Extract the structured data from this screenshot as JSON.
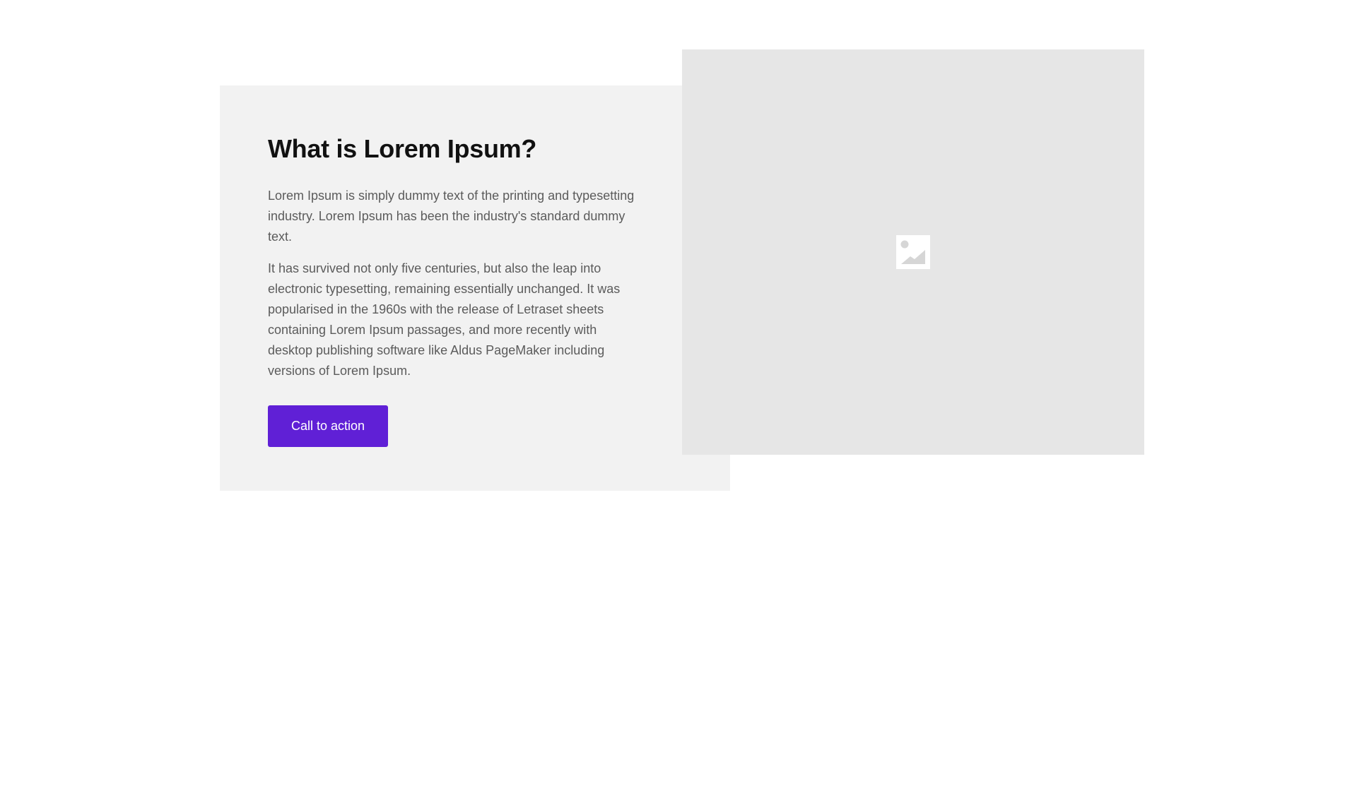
{
  "section": {
    "heading": "What is Lorem Ipsum?",
    "paragraphs": [
      "Lorem Ipsum is simply dummy text of the printing and typesetting industry. Lorem Ipsum has been the industry's standard dummy text.",
      "It has survived not only five centuries, but also the leap into electronic typesetting, remaining essentially unchanged. It was popularised in the 1960s with the release of Letraset sheets containing Lorem Ipsum passages, and more recently with desktop publishing software like Aldus PageMaker including versions of Lorem Ipsum."
    ],
    "cta_label": "Call to action"
  },
  "image": {
    "icon": "image-placeholder-icon"
  },
  "colors": {
    "accent": "#6020d6",
    "card_background": "#f2f2f2",
    "image_background": "#e6e6e6",
    "heading_text": "#111111",
    "body_text": "#5b5b5b"
  }
}
